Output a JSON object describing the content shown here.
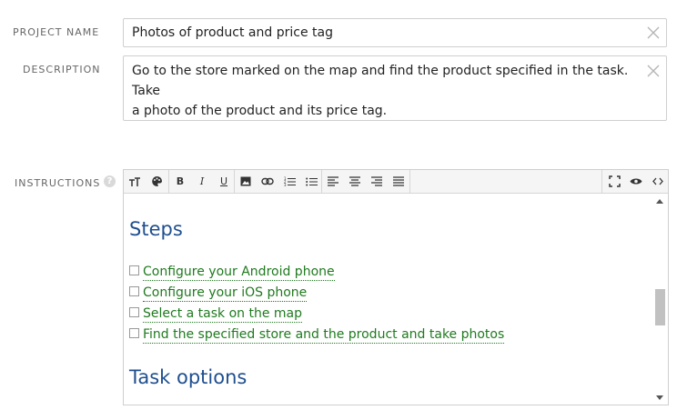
{
  "project_name": {
    "label": "PROJECT NAME",
    "value": "Photos of product and price tag"
  },
  "description": {
    "label": "DESCRIPTION",
    "line1": "Go to the store marked on the map and find the product specified in the task. Take",
    "line2": "a photo of the product and its price tag."
  },
  "instructions": {
    "label": "INSTRUCTIONS",
    "help": "?",
    "toolbar": {
      "text_size": "ʭ",
      "bold": "B",
      "italic": "I",
      "underline": "U"
    },
    "heading_steps": "Steps",
    "todos": [
      "Configure your Android phone",
      "Configure your iOS phone",
      "Select a task on the map",
      "Find the specified store and the product and take photos"
    ],
    "heading_task_options": "Task options"
  },
  "colors": {
    "heading": "#1f4f8f",
    "link_green": "#1f7a1f"
  }
}
